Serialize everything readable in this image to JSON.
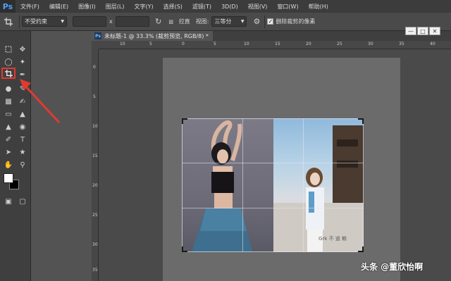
{
  "menu": {
    "logo": "Ps",
    "items": [
      "文件(F)",
      "编辑(E)",
      "图像(I)",
      "图层(L)",
      "文字(Y)",
      "选择(S)",
      "滤镜(T)",
      "3D(D)",
      "视图(V)",
      "窗口(W)",
      "帮助(H)"
    ]
  },
  "options": {
    "ratio_select": "不受约束",
    "x_label": "x",
    "straighten_label": "拉直",
    "view_label": "视图:",
    "view_select": "三等分",
    "delete_cropped_label": "删除裁剪的像素",
    "delete_cropped_checked": true
  },
  "document": {
    "tab_title": "未标题-1 @ 33.3% (裁剪预览, RGB/8) *",
    "ps_badge": "Ps"
  },
  "ruler": {
    "h_ticks": [
      "10",
      "5",
      "0",
      "5",
      "10",
      "15",
      "20",
      "25",
      "30",
      "35",
      "40"
    ],
    "v_ticks": [
      "0",
      "5",
      "10",
      "15",
      "20",
      "25",
      "30",
      "35"
    ]
  },
  "photo": {
    "caption_text": "Grk 不 道 赖"
  },
  "watermark": "头条 @董欣怡啊",
  "colors": {
    "highlight": "#e23a2f",
    "ps_blue": "#4aa3ff"
  }
}
